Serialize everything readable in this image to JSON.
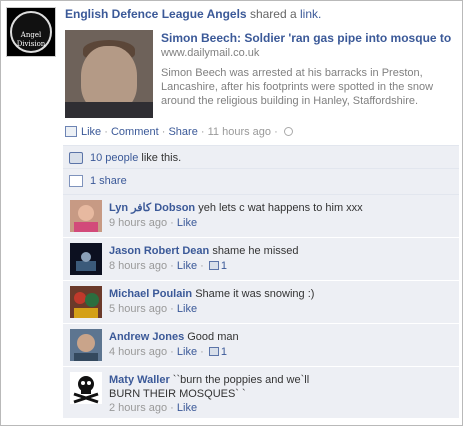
{
  "post": {
    "author": "English Defence League Angels",
    "action_text": "shared a",
    "action_link": "link.",
    "avatar_text": "Angel Division",
    "link": {
      "title": "Simon Beech: Soldier 'ran gas pipe into mosque to",
      "url": "www.dailymail.co.uk",
      "description": "Simon Beech was arrested at his barracks in Preston, Lancashire, after his footprints were spotted in the snow around the religious building in Hanley, Staffordshire."
    },
    "actions": {
      "like": "Like",
      "comment": "Comment",
      "share": "Share",
      "time": "11 hours ago",
      "sep": "·"
    }
  },
  "ufi": {
    "likes_link": "10 people",
    "likes_suffix": "like this.",
    "shares": "1 share"
  },
  "comments": [
    {
      "name": "Lyn كافر Dobson",
      "text": "yeh lets c wat happens to him xxx",
      "time": "9 hours ago",
      "like": "Like",
      "likes": ""
    },
    {
      "name": "Jason Robert Dean",
      "text": "shame he missed",
      "time": "8 hours ago",
      "like": "Like",
      "likes": "1"
    },
    {
      "name": "Michael Poulain",
      "text": "Shame it was snowing :)",
      "time": "5 hours ago",
      "like": "Like",
      "likes": ""
    },
    {
      "name": "Andrew Jones",
      "text": "Good man",
      "time": "4 hours ago",
      "like": "Like",
      "likes": "1"
    },
    {
      "name": "Maty Waller",
      "text": "``burn the poppies and we`ll BURN THEIR MOSQUES` `",
      "time": "2 hours ago",
      "like": "Like",
      "likes": ""
    }
  ],
  "colors": {
    "link": "#3b5998",
    "ufi_bg": "#edeff4"
  }
}
